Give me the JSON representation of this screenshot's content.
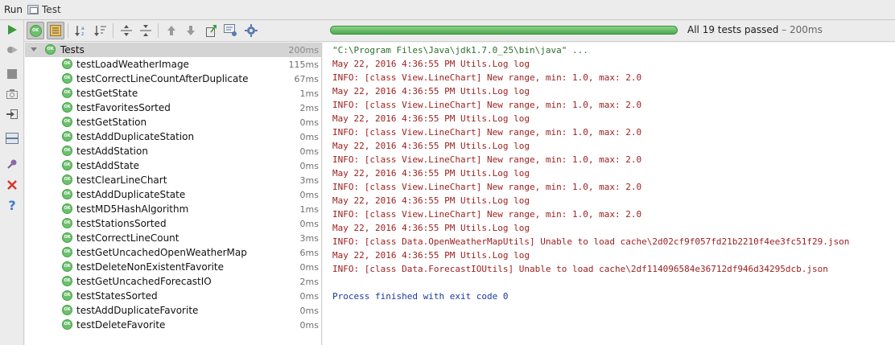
{
  "window": {
    "title": "Run",
    "tab_label": "Test"
  },
  "toolbar": {
    "left_tools": [
      "run-icon",
      "rerun-failed-icon",
      "stop-icon",
      "screenshot-icon",
      "import-icon",
      "layout-icon",
      "pin-icon",
      "close-icon",
      "help-icon"
    ],
    "top_tools": [
      "show-passed-icon",
      "show-ignored-icon",
      "sort-alpha-icon",
      "sort-duration-icon",
      "expand-all-icon",
      "collapse-all-icon",
      "previous-failed-icon",
      "next-failed-icon",
      "export-icon",
      "import-results-icon",
      "settings-icon"
    ],
    "show_passed_badge": "OK"
  },
  "progress": {
    "fraction": 1.0,
    "color": "#5fb45f"
  },
  "status": {
    "summary": "All 19 tests passed",
    "separator": " – ",
    "duration": "200ms"
  },
  "tree": {
    "root": {
      "name": "Tests",
      "duration": "200ms",
      "badge": "OK"
    },
    "tests": [
      {
        "name": "testLoadWeatherImage",
        "duration": "115ms"
      },
      {
        "name": "testCorrectLineCountAfterDuplicate",
        "duration": "67ms"
      },
      {
        "name": "testGetState",
        "duration": "1ms"
      },
      {
        "name": "testFavoritesSorted",
        "duration": "2ms"
      },
      {
        "name": "testGetStation",
        "duration": "0ms"
      },
      {
        "name": "testAddDuplicateStation",
        "duration": "0ms"
      },
      {
        "name": "testAddStation",
        "duration": "0ms"
      },
      {
        "name": "testAddState",
        "duration": "0ms"
      },
      {
        "name": "testClearLineChart",
        "duration": "3ms"
      },
      {
        "name": "testAddDuplicateState",
        "duration": "0ms"
      },
      {
        "name": "testMD5HashAlgorithm",
        "duration": "1ms"
      },
      {
        "name": "testStationsSorted",
        "duration": "0ms"
      },
      {
        "name": "testCorrectLineCount",
        "duration": "3ms"
      },
      {
        "name": "testGetUncachedOpenWeatherMap",
        "duration": "6ms"
      },
      {
        "name": "testDeleteNonExistentFavorite",
        "duration": "0ms"
      },
      {
        "name": "testGetUncachedForecastIO",
        "duration": "2ms"
      },
      {
        "name": "testStatesSorted",
        "duration": "0ms"
      },
      {
        "name": "testAddDuplicateFavorite",
        "duration": "0ms"
      },
      {
        "name": "testDeleteFavorite",
        "duration": "0ms"
      }
    ],
    "badge": "OK"
  },
  "console": {
    "lines": [
      {
        "text": "\"C:\\Program Files\\Java\\jdk1.7.0_25\\bin\\java\" ...",
        "kind": "cmd"
      },
      {
        "text": "May 22, 2016 4:36:55 PM Utils.Log log",
        "kind": "log"
      },
      {
        "text": "INFO: [class View.LineChart] New range, min: 1.0, max: 2.0",
        "kind": "log"
      },
      {
        "text": "May 22, 2016 4:36:55 PM Utils.Log log",
        "kind": "log"
      },
      {
        "text": "INFO: [class View.LineChart] New range, min: 1.0, max: 2.0",
        "kind": "log"
      },
      {
        "text": "May 22, 2016 4:36:55 PM Utils.Log log",
        "kind": "log"
      },
      {
        "text": "INFO: [class View.LineChart] New range, min: 1.0, max: 2.0",
        "kind": "log"
      },
      {
        "text": "May 22, 2016 4:36:55 PM Utils.Log log",
        "kind": "log"
      },
      {
        "text": "INFO: [class View.LineChart] New range, min: 1.0, max: 2.0",
        "kind": "log"
      },
      {
        "text": "May 22, 2016 4:36:55 PM Utils.Log log",
        "kind": "log"
      },
      {
        "text": "INFO: [class View.LineChart] New range, min: 1.0, max: 2.0",
        "kind": "log"
      },
      {
        "text": "May 22, 2016 4:36:55 PM Utils.Log log",
        "kind": "log"
      },
      {
        "text": "INFO: [class View.LineChart] New range, min: 1.0, max: 2.0",
        "kind": "log"
      },
      {
        "text": "May 22, 2016 4:36:55 PM Utils.Log log",
        "kind": "log"
      },
      {
        "text": "INFO: [class Data.OpenWeatherMapUtils] Unable to load cache\\2d02cf9f057fd21b2210f4ee3fc51f29.json",
        "kind": "log"
      },
      {
        "text": "May 22, 2016 4:36:55 PM Utils.Log log",
        "kind": "log"
      },
      {
        "text": "INFO: [class Data.ForecastIOUtils] Unable to load cache\\2df114096584e36712df946d34295dcb.json",
        "kind": "log"
      },
      {
        "text": "",
        "kind": "blank"
      },
      {
        "text": "Process finished with exit code 0",
        "kind": "exit"
      }
    ]
  }
}
